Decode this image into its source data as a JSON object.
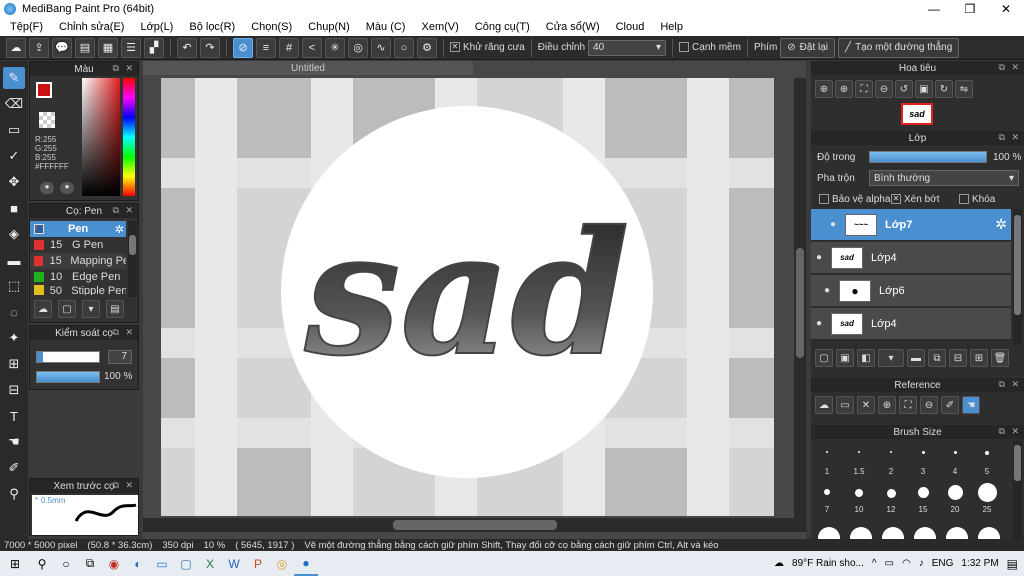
{
  "window": {
    "title": "MediBang Paint Pro (64bit)",
    "min": "—",
    "max": "❐",
    "close": "✕"
  },
  "menu": [
    "Tệp(F)",
    "Chỉnh sửa(E)",
    "Lớp(L)",
    "Bộ lọc(R)",
    "Chọn(S)",
    "Chụp(N)",
    "Màu (C)",
    "Xem(V)",
    "Công cụ(T)",
    "Cửa sổ(W)",
    "Cloud",
    "Help"
  ],
  "toolbar": {
    "antialias_label": "Khử răng cưa",
    "adjust_label": "Điều chỉnh",
    "adjust_value": "40",
    "smooth_label": "Cạnh mềm",
    "key_label": "Phím",
    "reset_label": "Đặt lại",
    "line_label": "Tạo một đường thẳng"
  },
  "color_panel": {
    "title": "Màu",
    "r": "R:255",
    "g": "G:255",
    "b": "B:255",
    "hex": "#FFFFFF",
    "fg_color": "#cc1111"
  },
  "brush_panel": {
    "title": "Cọ: Pen",
    "items": [
      {
        "size": "",
        "name": "Pen",
        "color": "#2d5f9a"
      },
      {
        "size": "15",
        "name": "G Pen",
        "color": "#e03030"
      },
      {
        "size": "15",
        "name": "Mapping Pe",
        "color": "#e03030"
      },
      {
        "size": "10",
        "name": "Edge Pen",
        "color": "#20b020"
      },
      {
        "size": "50",
        "name": "Stipple Pen",
        "color": "#e0c020"
      }
    ]
  },
  "brush_control": {
    "title": "Kiểm soát cọ",
    "size": "7",
    "opacity": "100 %"
  },
  "preview": {
    "title": "Xem trước cọ",
    "size": "0.5mm"
  },
  "canvas": {
    "tab": "Untitled",
    "art_text": "sad"
  },
  "navigator": {
    "title": "Hoa tiêu",
    "thumb_text": "sad"
  },
  "layer_panel": {
    "title": "Lớp",
    "opacity_label": "Độ trong",
    "opacity_value": "100 %",
    "blend_label": "Pha trộn",
    "blend_value": "Bình thường",
    "protect_alpha": "Bảo vệ alpha",
    "clipping": "Xén bớt",
    "lock": "Khóa",
    "layers": [
      {
        "name": "Lớp7",
        "thumb": "~~~",
        "selected": true
      },
      {
        "name": "Lớp4",
        "thumb": "sad",
        "selected": false
      },
      {
        "name": "Lớp6",
        "thumb": "●",
        "selected": false
      },
      {
        "name": "Lớp4",
        "thumb": "sad",
        "selected": false
      }
    ]
  },
  "reference": {
    "title": "Reference"
  },
  "brush_size": {
    "title": "Brush Size",
    "row1": [
      "1",
      "1.5",
      "2",
      "3",
      "4",
      "5"
    ],
    "row2": [
      "7",
      "10",
      "12",
      "15",
      "20",
      "25"
    ]
  },
  "status": {
    "dimensions": "7000 * 5000 pixel",
    "cm": "(50.8 * 36.3cm)",
    "dpi": "350 dpi",
    "zoom": "10 %",
    "coords": "( 5645, 1917 )",
    "hint": "Vẽ một đường thẳng bằng cách giữ phím Shift, Thay đổi cỡ cọ bằng cách giữ phím Ctrl, Alt và kéo"
  },
  "taskbar": {
    "weather": "89°F  Rain sho...",
    "lang": "ENG",
    "time": "1:32 PM"
  }
}
